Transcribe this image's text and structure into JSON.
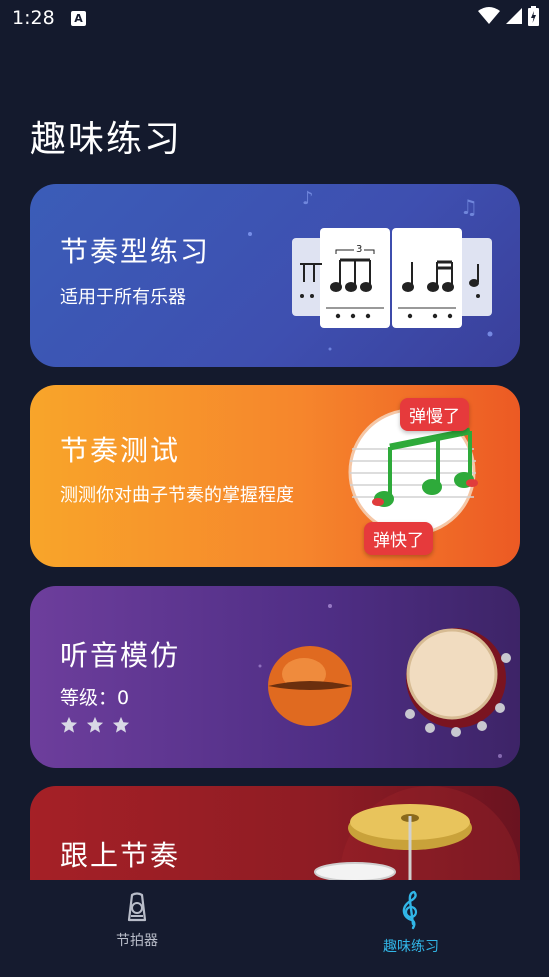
{
  "status": {
    "time": "1:28",
    "notif_glyph": "A"
  },
  "page_title": "趣味练习",
  "cards": [
    {
      "title": "节奏型练习",
      "subtitle": "适用于所有乐器",
      "triplet_mark": "3"
    },
    {
      "title": "节奏测试",
      "subtitle": "测测你对曲子节奏的掌握程度",
      "badge_slow": "弹慢了",
      "badge_fast": "弹快了"
    },
    {
      "title": "听音模仿",
      "level_label": "等级：",
      "level_value": "0"
    },
    {
      "title": "跟上节奏"
    }
  ],
  "nav": {
    "items": [
      {
        "label": "节拍器",
        "icon": "metronome-icon"
      },
      {
        "label": "趣味练习",
        "icon": "treble-clef-icon"
      }
    ]
  },
  "colors": {
    "background": "#141a2d",
    "accent": "#31b6e7",
    "card1": "#3e4fb0",
    "card2": "#f6862c",
    "card3": "#4f2e85",
    "card4": "#8e1c24"
  }
}
